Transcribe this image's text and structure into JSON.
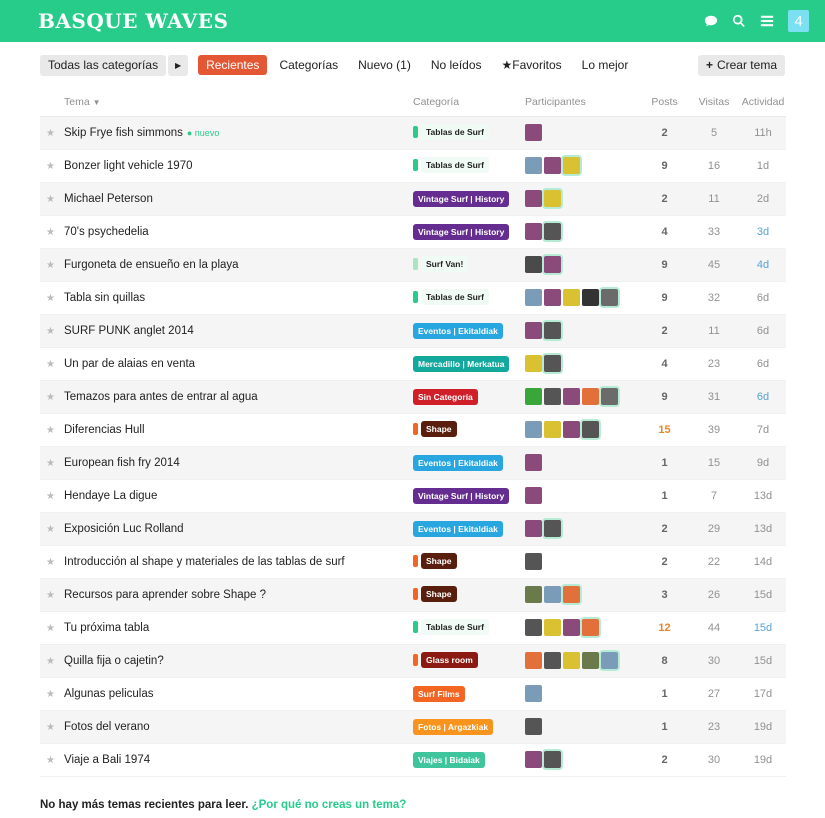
{
  "header": {
    "logo": "BASQUE WAVES",
    "notif_count": "4",
    "icons": [
      "chat-icon",
      "search-icon",
      "menu-icon"
    ]
  },
  "nav": {
    "category_dropdown": "Todas las categorías",
    "links": [
      {
        "label": "Recientes",
        "active": true
      },
      {
        "label": "Categorías",
        "active": false
      },
      {
        "label": "Nuevo (1)",
        "active": false
      },
      {
        "label": "No leídos",
        "active": false
      },
      {
        "label": "★Favoritos",
        "active": false
      },
      {
        "label": "Lo mejor",
        "active": false
      }
    ],
    "create_label": "Crear tema"
  },
  "columns": {
    "title": "Tema",
    "category": "Categoría",
    "participants": "Participantes",
    "posts": "Posts",
    "views": "Visitas",
    "activity": "Actividad"
  },
  "colors": {
    "tablas": "#27cc8a",
    "vintage": "#652d90",
    "surfvan": "#a8e6bf",
    "eventos": "#27a6e0",
    "mercadillo": "#12a89d",
    "sincat": "#cf1f29",
    "shape": "#5a1e0e",
    "glass": "#8b1a12",
    "films": "#f26522",
    "fotos": "#f7941d",
    "viajes": "#3ec59d",
    "stripe_shape": "#f26522",
    "stripe_glass": "#f26522"
  },
  "topics": [
    {
      "title": "Skip Frye fish simmons",
      "new": "nuevo",
      "cat": "Tablas de Surf",
      "cat_style": "tablas",
      "avatars": [
        "#8a4a7a"
      ],
      "posts": "2",
      "views": "5",
      "activity": "11h",
      "act_blue": false,
      "hot": false
    },
    {
      "title": "Bonzer light vehicle 1970",
      "new": "",
      "cat": "Tablas de Surf",
      "cat_style": "tablas",
      "avatars": [
        "#7b9cb8",
        "#8a4a7a",
        "#d9c132"
      ],
      "posts": "9",
      "views": "16",
      "activity": "1d",
      "act_blue": false,
      "hot": false
    },
    {
      "title": "Michael Peterson",
      "new": "",
      "cat": "Vintage Surf | History",
      "cat_style": "vintage",
      "avatars": [
        "#8a4a7a",
        "#d9c132"
      ],
      "posts": "2",
      "views": "11",
      "activity": "2d",
      "act_blue": false,
      "hot": false
    },
    {
      "title": "70's psychedelia",
      "new": "",
      "cat": "Vintage Surf | History",
      "cat_style": "vintage",
      "avatars": [
        "#8a4a7a",
        "#555555"
      ],
      "posts": "4",
      "views": "33",
      "activity": "3d",
      "act_blue": true,
      "hot": false
    },
    {
      "title": "Furgoneta de ensueño en la playa",
      "new": "",
      "cat": "Surf Van!",
      "cat_style": "surfvan",
      "avatars": [
        "#4a4a4a",
        "#8a4a7a"
      ],
      "posts": "9",
      "views": "45",
      "activity": "4d",
      "act_blue": true,
      "hot": false
    },
    {
      "title": "Tabla sin quillas",
      "new": "",
      "cat": "Tablas de Surf",
      "cat_style": "tablas",
      "avatars": [
        "#7b9cb8",
        "#8a4a7a",
        "#d9c132",
        "#333333",
        "#6b6b6b"
      ],
      "posts": "9",
      "views": "32",
      "activity": "6d",
      "act_blue": false,
      "hot": false
    },
    {
      "title": "SURF PUNK anglet 2014",
      "new": "",
      "cat": "Eventos | Ekitaldiak",
      "cat_style": "eventos",
      "avatars": [
        "#8a4a7a",
        "#555555"
      ],
      "posts": "2",
      "views": "11",
      "activity": "6d",
      "act_blue": false,
      "hot": false
    },
    {
      "title": "Un par de alaias en venta",
      "new": "",
      "cat": "Mercadillo | Merkatua",
      "cat_style": "mercadillo",
      "avatars": [
        "#d9c132",
        "#555555"
      ],
      "posts": "4",
      "views": "23",
      "activity": "6d",
      "act_blue": false,
      "hot": false
    },
    {
      "title": "Temazos para antes de entrar al agua",
      "new": "",
      "cat": "Sin Categoría",
      "cat_style": "sincat",
      "avatars": [
        "#3aa63a",
        "#555555",
        "#8a4a7a",
        "#e2703a",
        "#6b6b6b"
      ],
      "posts": "9",
      "views": "31",
      "activity": "6d",
      "act_blue": true,
      "hot": false
    },
    {
      "title": "Diferencias Hull",
      "new": "",
      "cat": "Shape",
      "cat_style": "shape",
      "avatars": [
        "#7b9cb8",
        "#d9c132",
        "#8a4a7a",
        "#555555"
      ],
      "posts": "15",
      "views": "39",
      "activity": "7d",
      "act_blue": false,
      "hot": true
    },
    {
      "title": "European fish fry 2014",
      "new": "",
      "cat": "Eventos | Ekitaldiak",
      "cat_style": "eventos",
      "avatars": [
        "#8a4a7a"
      ],
      "posts": "1",
      "views": "15",
      "activity": "9d",
      "act_blue": false,
      "hot": false
    },
    {
      "title": "Hendaye La digue",
      "new": "",
      "cat": "Vintage Surf | History",
      "cat_style": "vintage",
      "avatars": [
        "#8a4a7a"
      ],
      "posts": "1",
      "views": "7",
      "activity": "13d",
      "act_blue": false,
      "hot": false
    },
    {
      "title": "Exposición Luc Rolland",
      "new": "",
      "cat": "Eventos | Ekitaldiak",
      "cat_style": "eventos",
      "avatars": [
        "#8a4a7a",
        "#555555"
      ],
      "posts": "2",
      "views": "29",
      "activity": "13d",
      "act_blue": false,
      "hot": false
    },
    {
      "title": "Introducción al shape y materiales de las tablas de surf",
      "new": "",
      "cat": "Shape",
      "cat_style": "shape",
      "avatars": [
        "#555555"
      ],
      "posts": "2",
      "views": "22",
      "activity": "14d",
      "act_blue": false,
      "hot": false
    },
    {
      "title": "Recursos para aprender sobre Shape ?",
      "new": "",
      "cat": "Shape",
      "cat_style": "shape",
      "avatars": [
        "#6a7a4a",
        "#7b9cb8",
        "#e2703a"
      ],
      "posts": "3",
      "views": "26",
      "activity": "15d",
      "act_blue": false,
      "hot": false
    },
    {
      "title": "Tu próxima tabla",
      "new": "",
      "cat": "Tablas de Surf",
      "cat_style": "tablas",
      "avatars": [
        "#555555",
        "#d9c132",
        "#8a4a7a",
        "#e2703a"
      ],
      "posts": "12",
      "views": "44",
      "activity": "15d",
      "act_blue": true,
      "hot": true
    },
    {
      "title": "Quilla fija o cajetin?",
      "new": "",
      "cat": "Glass room",
      "cat_style": "glass",
      "avatars": [
        "#e2703a",
        "#555555",
        "#d9c132",
        "#6a7a4a",
        "#7b9cb8"
      ],
      "posts": "8",
      "views": "30",
      "activity": "15d",
      "act_blue": false,
      "hot": false
    },
    {
      "title": "Algunas peliculas",
      "new": "",
      "cat": "Surf Films",
      "cat_style": "films",
      "avatars": [
        "#7b9cb8"
      ],
      "posts": "1",
      "views": "27",
      "activity": "17d",
      "act_blue": false,
      "hot": false
    },
    {
      "title": "Fotos del verano",
      "new": "",
      "cat": "Fotos | Argazkiak",
      "cat_style": "fotos",
      "avatars": [
        "#555555"
      ],
      "posts": "1",
      "views": "23",
      "activity": "19d",
      "act_blue": false,
      "hot": false
    },
    {
      "title": "Viaje a Bali 1974",
      "new": "",
      "cat": "Viajes | Bidaiak",
      "cat_style": "viajes",
      "avatars": [
        "#8a4a7a",
        "#555555"
      ],
      "posts": "2",
      "views": "30",
      "activity": "19d",
      "act_blue": false,
      "hot": false
    }
  ],
  "footer": {
    "text": "No hay más temas recientes para leer.",
    "link": "¿Por qué no creas un tema?"
  }
}
